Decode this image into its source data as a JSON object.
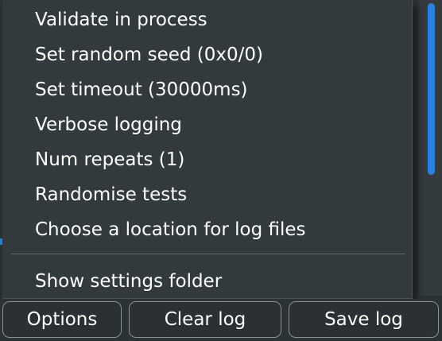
{
  "menu": {
    "items": [
      {
        "label": "Validate in process"
      },
      {
        "label": "Set random seed (0x0/0)"
      },
      {
        "label": "Set timeout (30000ms)"
      },
      {
        "label": "Verbose logging"
      },
      {
        "label": "Num repeats (1)"
      },
      {
        "label": "Randomise tests"
      },
      {
        "label": "Choose a location for log files"
      },
      {
        "label": "Show settings folder"
      }
    ]
  },
  "toolbar": {
    "options_label": "Options",
    "clear_label": "Clear log",
    "save_label": "Save log"
  },
  "colors": {
    "accent": "#2f7fd7",
    "menu_background": "#323a3e",
    "button_border": "#8b9296"
  }
}
